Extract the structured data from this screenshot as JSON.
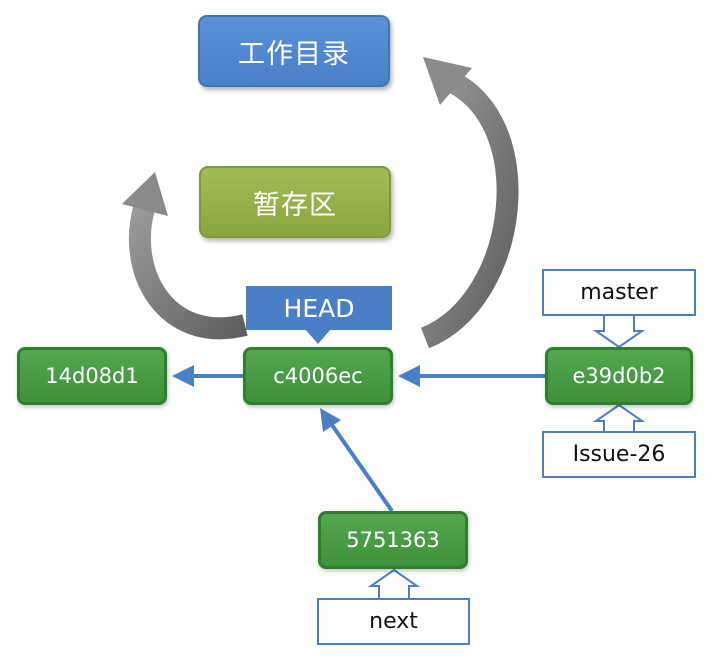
{
  "areas": {
    "working_directory": "工作目录",
    "staging_area": "暂存区"
  },
  "head_label": "HEAD",
  "commits": {
    "c1": "14d08d1",
    "c2": "c4006ec",
    "c3": "e39d0b2",
    "c4": "5751363"
  },
  "branches": {
    "master": "master",
    "issue": "Issue-26",
    "next": "next"
  },
  "colors": {
    "commit_fill": "#4b9e47",
    "commit_border": "#2f7f2d",
    "working_dir_fill": "#4a7fc6",
    "staging_fill": "#94ae49",
    "head_fill": "#4a7fc6",
    "arrow_blue": "#4a7fc6",
    "curved_arrow_gray": "#7a7a7a"
  }
}
